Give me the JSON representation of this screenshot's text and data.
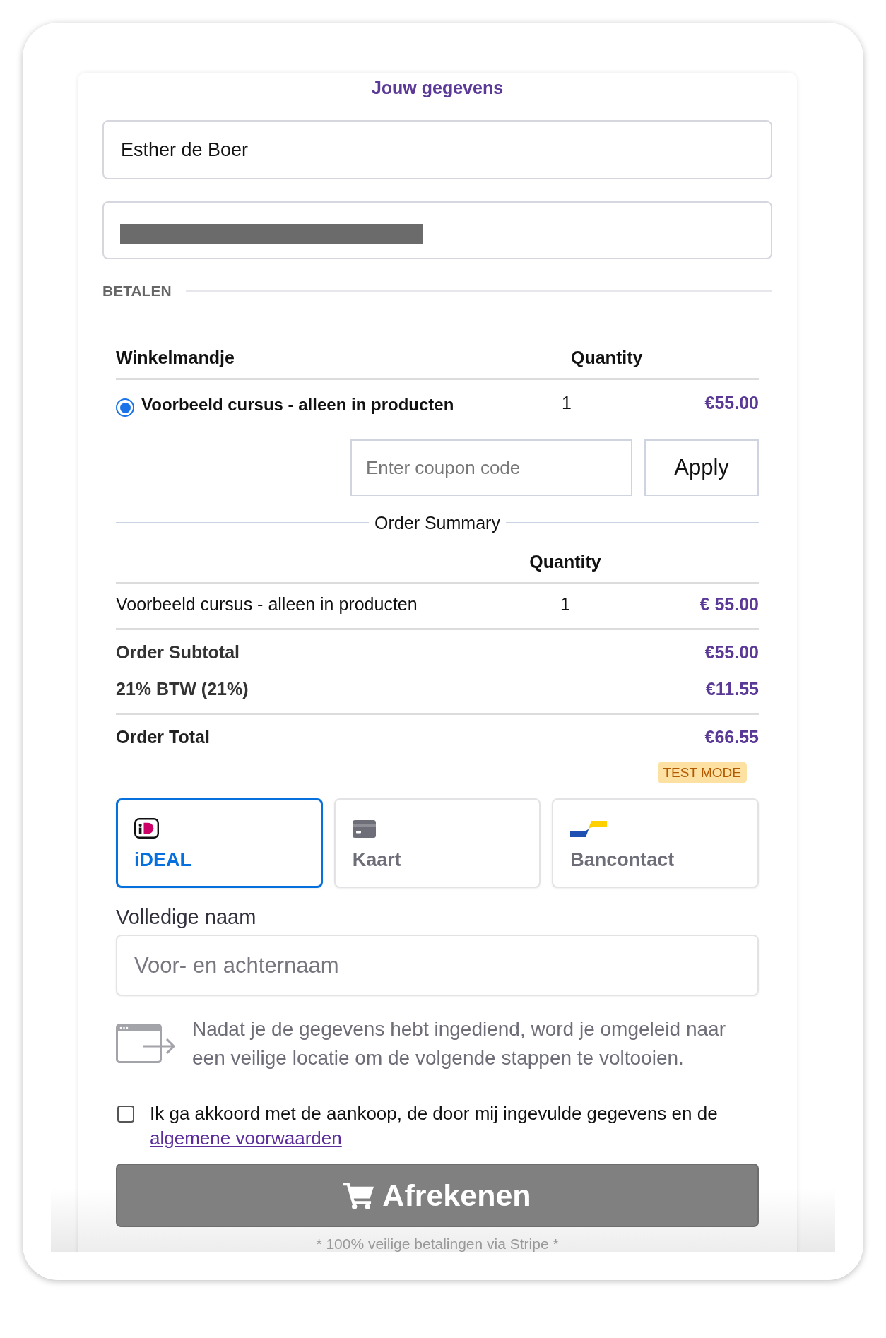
{
  "details": {
    "title": "Jouw gegevens",
    "fields": [
      {
        "kind": "text",
        "value": "Esther de Boer"
      },
      {
        "kind": "redacted"
      }
    ]
  },
  "payment": {
    "heading": "BETALEN"
  },
  "cart": {
    "columns": [
      "Winkelmandje",
      "Quantity"
    ],
    "items": [
      {
        "name": "Voorbeeld cursus - alleen in producten",
        "selected": true,
        "quantity": "1",
        "price": "€55.00"
      }
    ],
    "coupon": {
      "placeholder": "Enter coupon code",
      "button": "Apply"
    }
  },
  "order_summary": {
    "title": "Order Summary",
    "quantity_header": "Quantity",
    "items": [
      {
        "name": "Voorbeeld cursus - alleen in producten",
        "quantity": "1",
        "price": "€ 55.00"
      }
    ],
    "totals": [
      {
        "label": "Order Subtotal",
        "value": "€55.00"
      },
      {
        "label": "21% BTW (21%)",
        "value": "€11.55"
      }
    ],
    "grand_total": {
      "label": "Order Total",
      "value": "€66.55"
    }
  },
  "test_mode_badge": "TEST MODE",
  "payment_methods": [
    {
      "kind": "ideal",
      "label": "iDEAL",
      "selected": true
    },
    {
      "kind": "card",
      "label": "Kaart",
      "selected": false
    },
    {
      "kind": "bancontact",
      "label": "Bancontact",
      "selected": false
    }
  ],
  "name_field": {
    "label": "Volledige naam",
    "placeholder": "Voor- en achternaam"
  },
  "redirect_notice": "Nadat je de gegevens hebt ingediend, word je omgeleid naar een veilige locatie om de volgende stappen te voltooien.",
  "terms": {
    "checked": false,
    "text": "Ik ga akkoord met de aankoop, de door mij ingevulde gegevens en de",
    "link": "algemene voorwaarden"
  },
  "checkout_button": "Afrekenen",
  "footer_note": "* 100% veilige betalingen via Stripe *"
}
